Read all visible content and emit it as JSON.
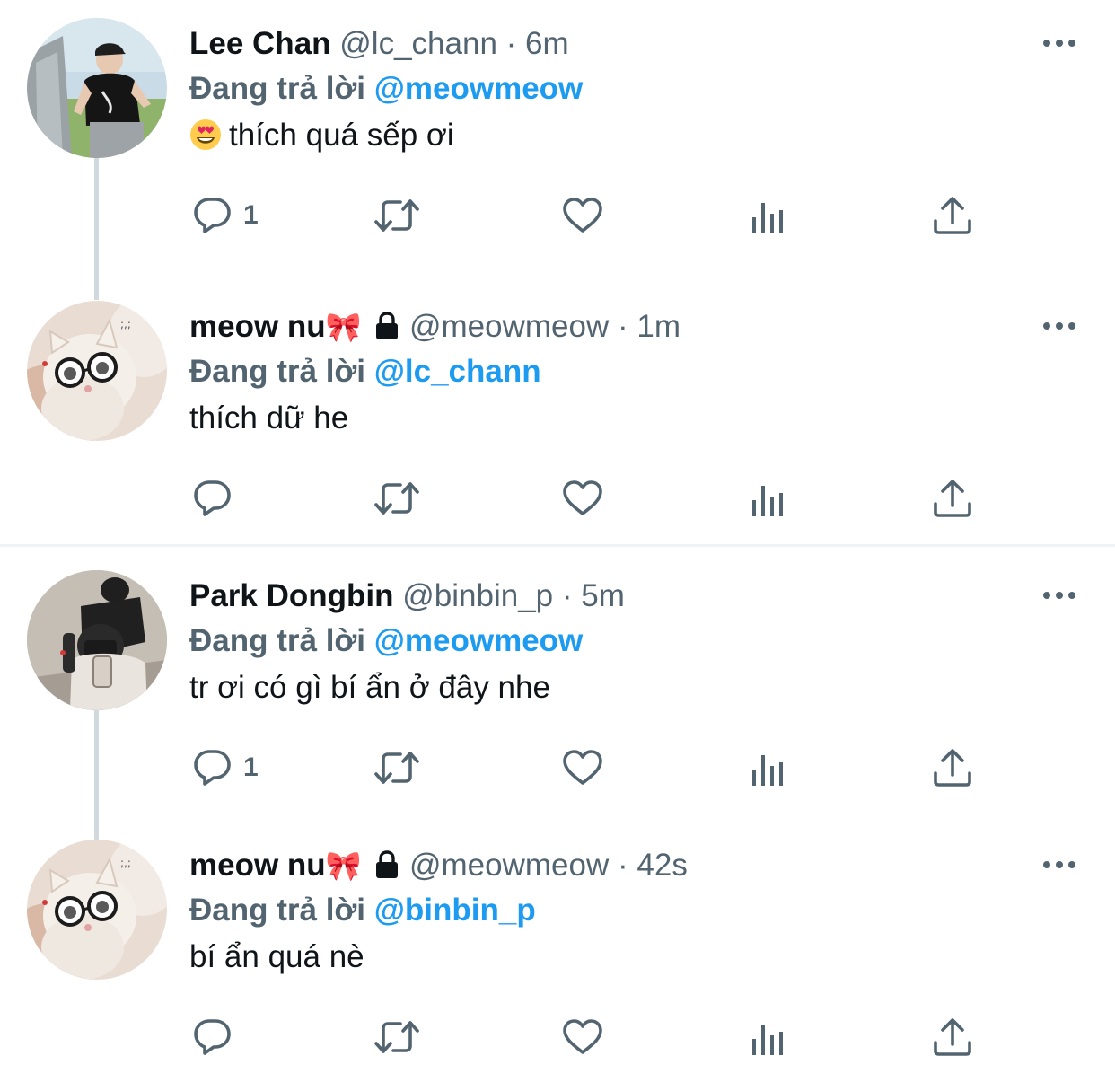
{
  "colors": {
    "text": "#0f1419",
    "secondary": "#536471",
    "link": "#1d9bf0",
    "thread_line": "#cfd9de",
    "divider": "#eff3f4"
  },
  "tweets": [
    {
      "name": "Lee Chan",
      "name_icons": "",
      "protected": false,
      "handle": "@lc_chann",
      "dot": "·",
      "time": "6m",
      "reply_prefix": "Đang trả lời",
      "reply_to": "@meowmeow",
      "text": "thích quá sếp ơi",
      "emoji": "smiling-face-with-heart-eyes",
      "reply_count": "1",
      "avatar": "person-in-cap-photo"
    },
    {
      "name": "meow nu",
      "name_icons": "🎀",
      "protected": true,
      "handle": "@meowmeow",
      "dot": "·",
      "time": "1m",
      "reply_prefix": "Đang trả lời",
      "reply_to": "@lc_chann",
      "text": "thích dữ he",
      "emoji": "",
      "reply_count": "",
      "avatar": "cat-with-glasses-photo"
    },
    {
      "name": "Park Dongbin",
      "name_icons": "",
      "protected": false,
      "handle": "@binbin_p",
      "dot": "·",
      "time": "5m",
      "reply_prefix": "Đang trả lời",
      "reply_to": "@meowmeow",
      "text": "tr ơi có gì bí ẩn ở đây nhe",
      "emoji": "",
      "reply_count": "1",
      "avatar": "mirror-selfie-photo"
    },
    {
      "name": "meow nu",
      "name_icons": "🎀",
      "protected": true,
      "handle": "@meowmeow",
      "dot": "·",
      "time": "42s",
      "reply_prefix": "Đang trả lời",
      "reply_to": "@binbin_p",
      "text": "bí ẩn quá nè",
      "emoji": "",
      "reply_count": "",
      "avatar": "cat-with-glasses-photo"
    }
  ],
  "icons": {
    "reply": "speech-bubble-icon",
    "retweet": "retweet-icon",
    "like": "heart-icon",
    "views": "bar-chart-icon",
    "share": "share-upload-icon",
    "more": "more-dots-icon",
    "lock": "lock-icon"
  }
}
